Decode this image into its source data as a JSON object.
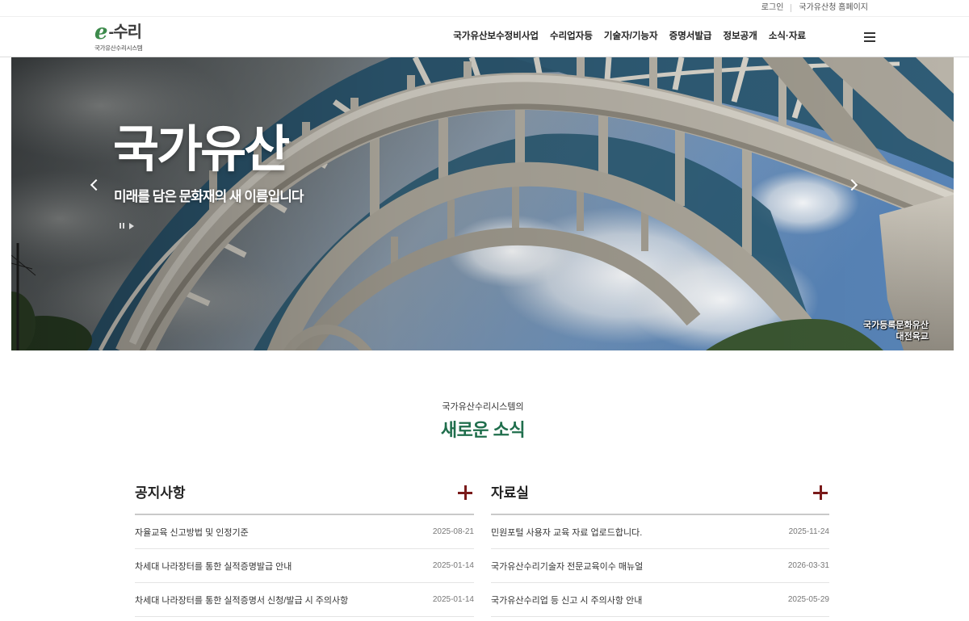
{
  "utility": {
    "login": "로그인",
    "homepage": "국가유산청 홈페이지"
  },
  "logo": {
    "mark": "e",
    "name": "-수리",
    "tagline": "국가유산수리시스템"
  },
  "nav": {
    "items": [
      "국가유산보수정비사업",
      "수리업자등",
      "기술자/기능자",
      "증명서발급",
      "정보공개",
      "소식·자료"
    ],
    "menu_icon": "hamburger-menu-icon"
  },
  "hero": {
    "title": "국가유산",
    "subtitle": "미래를 담은 문화재의 새 이름입니다",
    "caption_line1": "국가등록문화유산",
    "caption_line2": "대전육교",
    "prev_icon": "chevron-left-icon",
    "next_icon": "chevron-right-icon",
    "pause_icon": "pause-icon",
    "play_icon": "play-icon"
  },
  "news": {
    "eyebrow": "국가유산수리시스템의",
    "title": "새로운 소식",
    "boards": [
      {
        "title": "공지사항",
        "more_icon": "plus-icon",
        "items": [
          {
            "title": "자율교육 신고방법 및 인정기준",
            "date": "2025-08-21"
          },
          {
            "title": "차세대 나라장터를 통한 실적증명발급 안내",
            "date": "2025-01-14"
          },
          {
            "title": "차세대 나라장터를 통한 실적증명서 신청/발급 시 주의사항",
            "date": "2025-01-14"
          }
        ]
      },
      {
        "title": "자료실",
        "more_icon": "plus-icon",
        "items": [
          {
            "title": "민원포털 사용자 교육 자료 업로드합니다.",
            "date": "2025-11-24"
          },
          {
            "title": "국가유산수리기술자 전문교육이수 매뉴얼",
            "date": "2026-03-31"
          },
          {
            "title": "국가유산수리업 등 신고 시 주의사항 안내",
            "date": "2025-05-29"
          }
        ]
      }
    ]
  },
  "colors": {
    "accent_green": "#1f6e4c",
    "logo_green": "#3d8b4c",
    "more_icon_red": "#7a1a1a",
    "text": "#222222",
    "date_grey": "#777777"
  }
}
